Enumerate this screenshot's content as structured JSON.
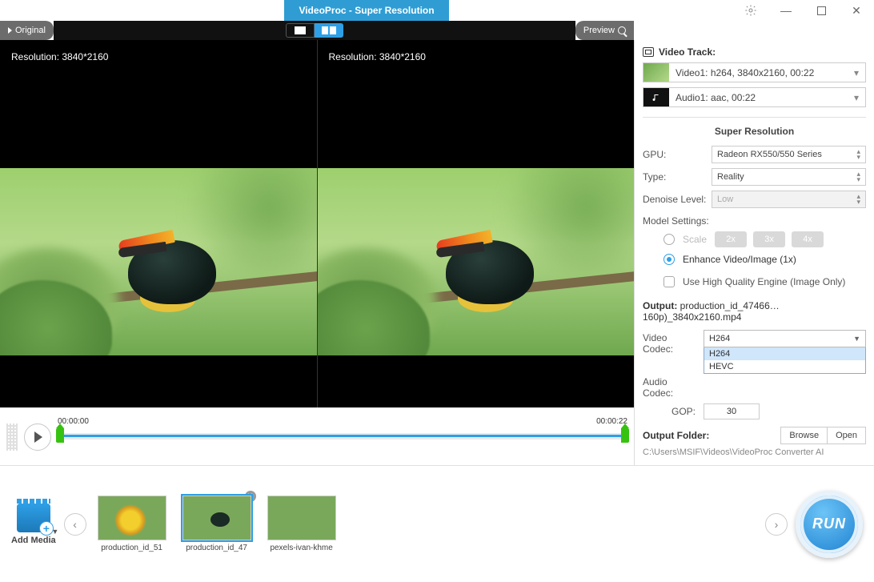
{
  "titlebar": {
    "title": "VideoProc  -  Super Resolution"
  },
  "topbar": {
    "original": "Original",
    "preview": "Preview"
  },
  "preview": {
    "left_res": "Resolution: 3840*2160",
    "right_res": "Resolution: 3840*2160"
  },
  "timeline": {
    "start": "00:00:00",
    "end": "00:00:22",
    "start2": "00:00:00",
    "end2": "00:00:22"
  },
  "side": {
    "track_title": "Video Track:",
    "video_track": "Video1: h264, 3840x2160, 00:22",
    "audio_track": "Audio1: aac, 00:22",
    "sr_title": "Super Resolution",
    "gpu_label": "GPU:",
    "gpu_value": "Radeon RX550/550 Series",
    "type_label": "Type:",
    "type_value": "Reality",
    "denoise_label": "Denoise Level:",
    "denoise_value": "Low",
    "model_label": "Model Settings:",
    "scale_label": "Scale",
    "scale_opts": [
      "2x",
      "3x",
      "4x"
    ],
    "enhance_label": "Enhance Video/Image (1x)",
    "hq_label": "Use High Quality Engine (Image Only)",
    "output_label": "Output:",
    "output_file": "production_id_47466…160p)_3840x2160.mp4",
    "vcodec_label": "Video Codec:",
    "vcodec_value": "H264",
    "vcodec_opts": [
      "H264",
      "HEVC"
    ],
    "acodec_label": "Audio Codec:",
    "gop_label": "GOP:",
    "gop_value": "30",
    "outfolder_label": "Output Folder:",
    "browse": "Browse",
    "open": "Open",
    "outfolder_path": "C:\\Users\\MSIF\\Videos\\VideoProc Converter AI"
  },
  "tray": {
    "add_media": "Add Media",
    "items": [
      {
        "cap": "production_id_51"
      },
      {
        "cap": "production_id_47"
      },
      {
        "cap": "pexels-ivan-khme"
      }
    ],
    "run": "RUN"
  }
}
